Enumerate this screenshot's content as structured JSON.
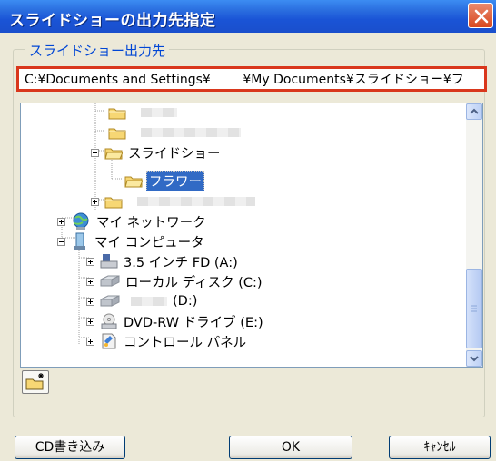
{
  "window": {
    "title": "スライドショーの出力先指定"
  },
  "group": {
    "legend": "スライドショー出力先"
  },
  "path": {
    "value": "C:¥Documents and Settings¥        ¥My Documents¥スライドショー¥フ"
  },
  "tree": {
    "items": [
      {
        "label": ""
      },
      {
        "label": ""
      },
      {
        "label": "スライドショー"
      },
      {
        "label": "フラワー"
      },
      {
        "label": ""
      },
      {
        "label": "マイ ネットワーク"
      },
      {
        "label": "マイ コンピュータ"
      },
      {
        "label": "3.5 インチ FD (A:)"
      },
      {
        "label": "ローカル ディスク (C:)"
      },
      {
        "label": "(D:)"
      },
      {
        "label": "DVD-RW ドライブ (E:)"
      },
      {
        "label": "コントロール パネル"
      }
    ]
  },
  "buttons": {
    "cd": "CD書き込み",
    "ok": "OK",
    "cancel": "ｷｬﾝｾﾙ"
  }
}
